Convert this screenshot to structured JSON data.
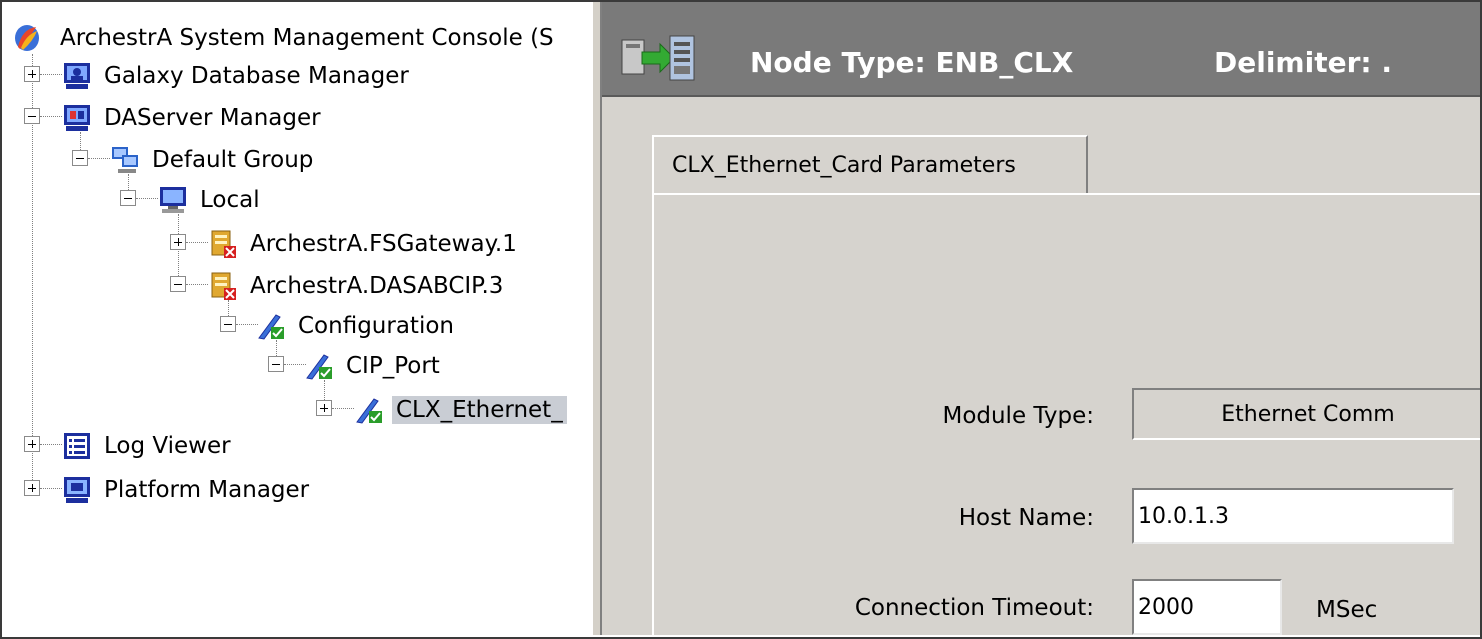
{
  "tree": {
    "root": {
      "label": "ArchestrA System Management Console (S",
      "icon": "archestra-console-icon"
    },
    "items": [
      {
        "label": "Galaxy Database Manager",
        "icon": "database-manager-icon",
        "expander": "+"
      },
      {
        "label": "DAServer Manager",
        "icon": "daserver-manager-icon",
        "expander": "-"
      },
      {
        "label": "Default Group",
        "icon": "group-icon",
        "expander": "-"
      },
      {
        "label": "Local",
        "icon": "computer-icon",
        "expander": "-"
      },
      {
        "label": "ArchestrA.FSGateway.1",
        "icon": "server-error-icon",
        "expander": "+"
      },
      {
        "label": "ArchestrA.DASABCIP.3",
        "icon": "server-error-icon",
        "expander": "-"
      },
      {
        "label": "Configuration",
        "icon": "config-check-icon",
        "expander": "-"
      },
      {
        "label": "CIP_Port",
        "icon": "config-check-icon",
        "expander": "-"
      },
      {
        "label": "CLX_Ethernet_",
        "icon": "config-check-icon",
        "expander": "+"
      },
      {
        "label": "Log Viewer",
        "icon": "log-viewer-icon",
        "expander": "+"
      },
      {
        "label": "Platform Manager",
        "icon": "platform-manager-icon",
        "expander": "+"
      }
    ]
  },
  "header": {
    "node_type": "Node Type: ENB_CLX",
    "delimiter": "Delimiter:  ."
  },
  "tab": {
    "label": "CLX_Ethernet_Card Parameters"
  },
  "form": {
    "module_type_label": "Module Type:",
    "module_type_value": "Ethernet Comm",
    "host_name_label": "Host Name:",
    "host_name_value": "10.0.1.3",
    "timeout_label": "Connection Timeout:",
    "timeout_value": "2000",
    "timeout_unit": "MSec"
  },
  "colors": {
    "header_bg": "#7a7a7a",
    "panel_bg": "#d6d3ce",
    "selection": "#c9cdd4"
  }
}
